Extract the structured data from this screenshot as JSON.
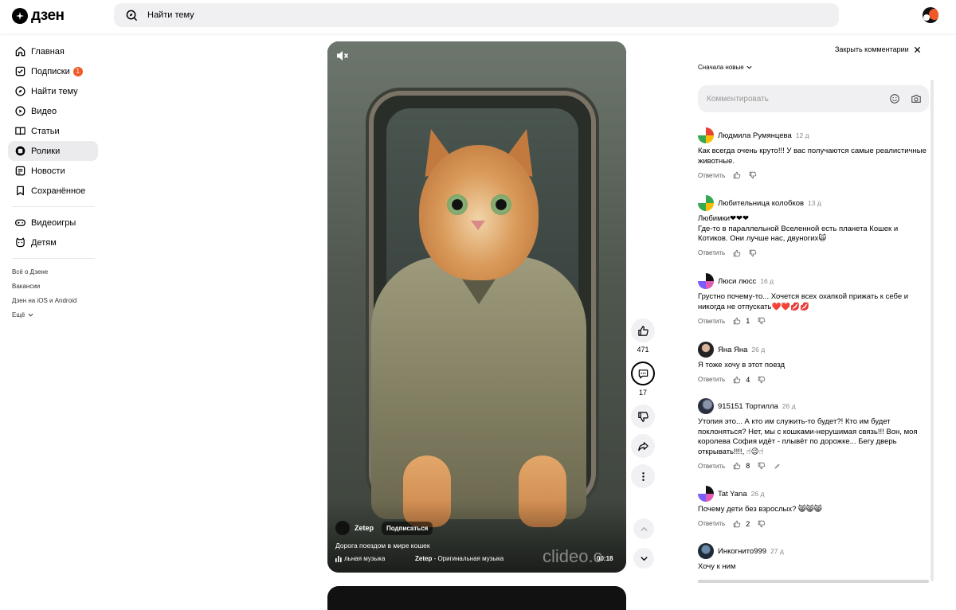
{
  "header": {
    "logo_text": "дзен",
    "search_placeholder": "Найти тему"
  },
  "sidebar": {
    "items": [
      {
        "label": "Главная",
        "icon": "home-icon"
      },
      {
        "label": "Подписки",
        "icon": "subscriptions-icon",
        "badge": "1"
      },
      {
        "label": "Найти тему",
        "icon": "compass-icon"
      },
      {
        "label": "Видео",
        "icon": "video-icon"
      },
      {
        "label": "Статьи",
        "icon": "book-icon"
      },
      {
        "label": "Ролики",
        "icon": "shorts-icon",
        "active": true
      },
      {
        "label": "Новости",
        "icon": "news-icon"
      },
      {
        "label": "Сохранённое",
        "icon": "bookmark-icon"
      }
    ],
    "secondary": [
      {
        "label": "Видеоигры",
        "icon": "gamepad-icon"
      },
      {
        "label": "Детям",
        "icon": "kids-icon"
      }
    ],
    "footer_links": [
      "Всё о Дзене",
      "Вакансии",
      "Дзен на iOS и Android",
      "Ещё"
    ]
  },
  "video": {
    "channel": "Zetep",
    "subscribe_label": "Подписаться",
    "title": "Дорога поездом в мире кошек",
    "music_left": "льная музыка",
    "music_author": "Zetep",
    "music_track": " - Оригинальная музыка",
    "watermark": "clideo.c",
    "duration": "00:18"
  },
  "actions": {
    "likes": "471",
    "comments": "17"
  },
  "comments_panel": {
    "close_label": "Закрыть комментарии",
    "sort_label": "Сначала новые",
    "input_placeholder": "Комментировать",
    "reply_label": "Ответить",
    "comments": [
      {
        "name": "Людмила Румянцева",
        "time": "12 д",
        "text": "Как всегда очень круто!!! У вас получаются самые реалистичные животные.",
        "likes": ""
      },
      {
        "name": "Любительница колобков",
        "time": "13 д",
        "text": "Любимки❤❤❤\nГде-то в параллельной Вселенной есть планета Кошек и Котиков. Они лучше нас, двуногих🙀",
        "likes": ""
      },
      {
        "name": "Люси люсс",
        "time": "16 д",
        "text": "Грустно почему-то... Хочется всех охапкой прижать к себе и никогда не отпускать❤️❤️💋💋",
        "likes": "1"
      },
      {
        "name": "Яна Яна",
        "time": "26 д",
        "text": "Я тоже хочу в этот поезд",
        "likes": "4"
      },
      {
        "name": "915151 Тортилла",
        "time": "26 д",
        "text": "Утопия это... А кто им служить-то будет?! Кто им будет поклоняться? Нет, мы с кошками-нерушимая связь!!! Вон, моя королева София идёт - плывёт по дорожке... Бегу дверь открывать!!!!, ☝😉☝",
        "likes": "8"
      },
      {
        "name": "Tat Yana",
        "time": "26 д",
        "text": "Почему дети без взрослых? 😸😸😸",
        "likes": "2"
      },
      {
        "name": "Инкогнито999",
        "time": "27 д",
        "text": "Хочу к ним",
        "likes": ""
      }
    ]
  }
}
